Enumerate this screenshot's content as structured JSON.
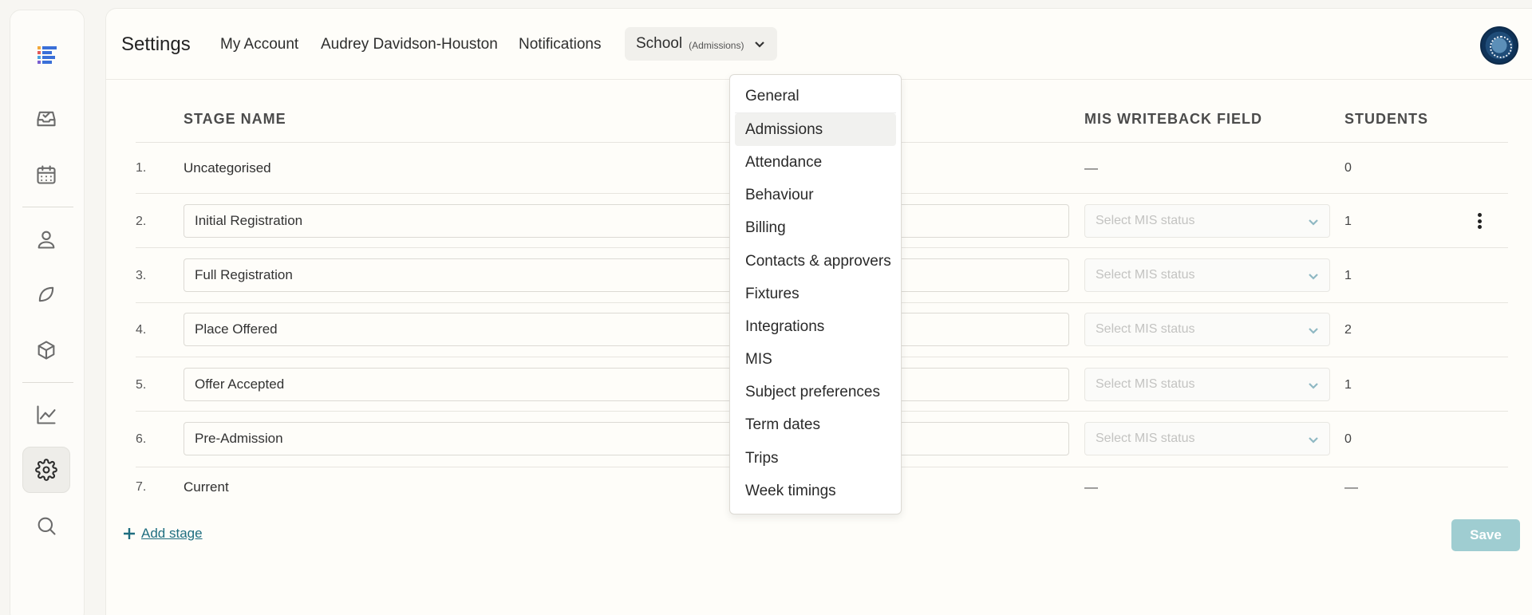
{
  "sidebar": {
    "items": [
      {
        "name": "inbox"
      },
      {
        "name": "calendar"
      },
      {
        "name": "user"
      },
      {
        "name": "leaf"
      },
      {
        "name": "box"
      },
      {
        "name": "chart"
      },
      {
        "name": "settings"
      },
      {
        "name": "search"
      }
    ]
  },
  "header": {
    "title": "Settings",
    "tabs": {
      "my_account": "My Account",
      "user": "Audrey Davidson-Houston",
      "notifications": "Notifications",
      "school": "School",
      "school_sub": "(Admissions)"
    }
  },
  "table": {
    "headers": {
      "stage_name": "STAGE NAME",
      "mis": "MIS WRITEBACK FIELD",
      "students": "STUDENTS"
    },
    "rows": [
      {
        "num": "1.",
        "name": "Uncategorised",
        "mis": "—",
        "students": "0"
      },
      {
        "num": "2.",
        "name": "Initial Registration",
        "mis": "Select MIS status",
        "students": "1"
      },
      {
        "num": "3.",
        "name": "Full Registration",
        "mis": "Select MIS status",
        "students": "1"
      },
      {
        "num": "4.",
        "name": "Place Offered",
        "mis": "Select MIS status",
        "students": "2"
      },
      {
        "num": "5.",
        "name": "Offer Accepted",
        "mis": "Select MIS status",
        "students": "1"
      },
      {
        "num": "6.",
        "name": "Pre-Admission",
        "mis": "Select MIS status",
        "students": "0"
      },
      {
        "num": "7.",
        "name": "Current",
        "mis": "—",
        "students": "—"
      }
    ]
  },
  "actions": {
    "add_stage": "Add stage",
    "save": "Save"
  },
  "dropdown": {
    "items": [
      "General",
      "Admissions",
      "Attendance",
      "Behaviour",
      "Billing",
      "Contacts & approvers",
      "Fixtures",
      "Integrations",
      "MIS",
      "Subject preferences",
      "Term dates",
      "Trips",
      "Week timings"
    ],
    "selected": "Admissions"
  },
  "colors": {
    "accent": "#1f6e80",
    "save_disabled": "#9fcdd1"
  }
}
